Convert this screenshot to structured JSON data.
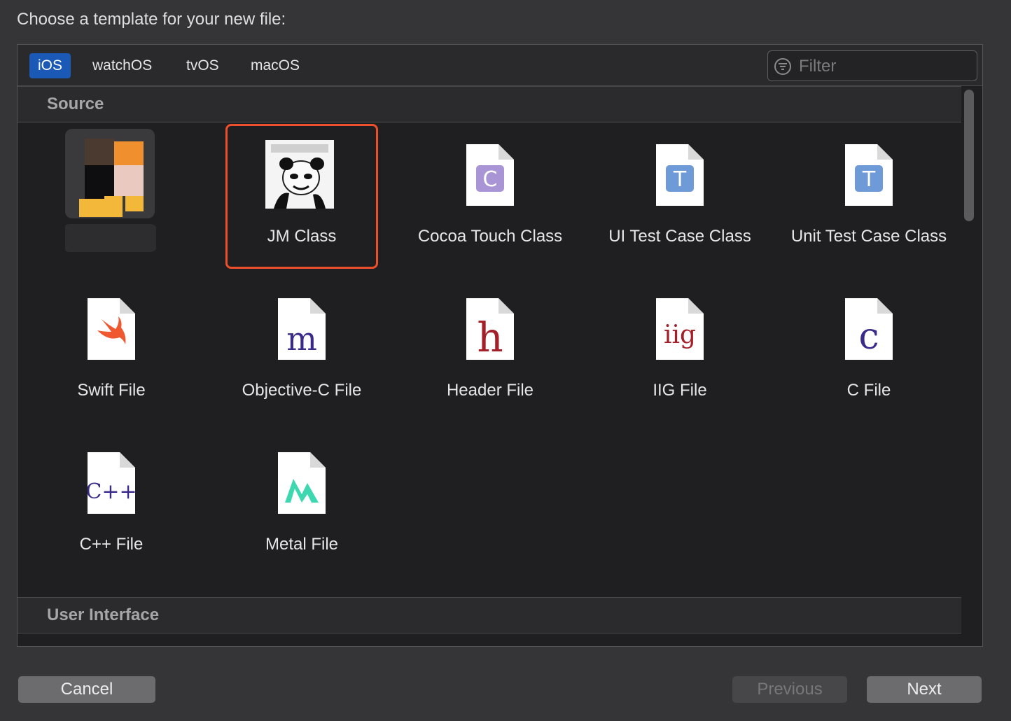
{
  "dialog": {
    "title": "Choose a template for your new file:"
  },
  "platforms": {
    "tabs": [
      {
        "label": "iOS",
        "active": true
      },
      {
        "label": "watchOS",
        "active": false
      },
      {
        "label": "tvOS",
        "active": false
      },
      {
        "label": "macOS",
        "active": false
      }
    ]
  },
  "filter": {
    "placeholder": "Filter",
    "value": ""
  },
  "sections": {
    "source": {
      "label": "Source"
    },
    "user_interface": {
      "label": "User Interface"
    }
  },
  "templates": [
    {
      "label": "",
      "icon": "custom-template-icon-blurred"
    },
    {
      "label": "JM Class",
      "icon": "jm-class-meme-icon",
      "selected": true
    },
    {
      "label": "Cocoa Touch Class",
      "icon": "cocoa-touch-class-icon",
      "letter": "C"
    },
    {
      "label": "UI Test Case Class",
      "icon": "ui-test-case-class-icon",
      "letter": "T"
    },
    {
      "label": "Unit Test Case Class",
      "icon": "unit-test-case-class-icon",
      "letter": "T"
    },
    {
      "label": "Swift File",
      "icon": "swift-file-icon"
    },
    {
      "label": "Objective-C File",
      "icon": "objective-c-file-icon",
      "letter": "m"
    },
    {
      "label": "Header File",
      "icon": "header-file-icon",
      "letter": "h"
    },
    {
      "label": "IIG File",
      "icon": "iig-file-icon",
      "letter": "iig"
    },
    {
      "label": "C File",
      "icon": "c-file-icon",
      "letter": "c"
    },
    {
      "label": "C++ File",
      "icon": "cpp-file-icon",
      "letter": "C++"
    },
    {
      "label": "Metal File",
      "icon": "metal-file-icon"
    }
  ],
  "colors": {
    "accent": "#1a59b5",
    "selection_outline": "#ec4f2c",
    "letter_red": "#a3202a",
    "letter_purple": "#3b2a8a",
    "cocoa_badge": "#a995d6",
    "test_badge": "#6f9ad8",
    "swift_orange": "#f0582f",
    "metal_teal": "#3ed8b0"
  },
  "buttons": {
    "cancel": "Cancel",
    "previous": "Previous",
    "next": "Next",
    "previous_enabled": false
  }
}
